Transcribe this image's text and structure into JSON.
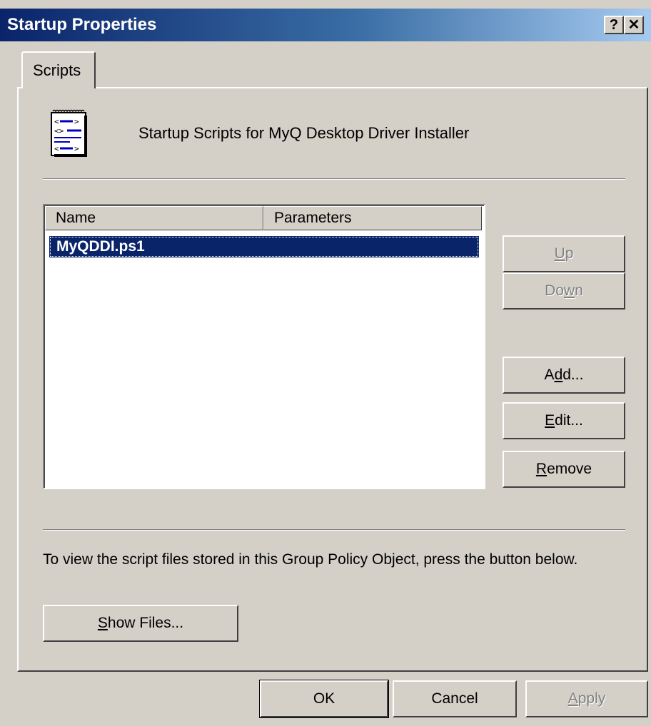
{
  "window": {
    "title": "Startup Properties",
    "help_label": "?",
    "close_label": "✕"
  },
  "tabs": [
    {
      "label": "Scripts",
      "selected": true
    }
  ],
  "header": {
    "icon": "script-icon",
    "text": "Startup Scripts for MyQ Desktop Driver Installer"
  },
  "list": {
    "columns": [
      "Name",
      "Parameters"
    ],
    "rows": [
      {
        "name": "MyQDDI.ps1",
        "parameters": "",
        "selected": true
      }
    ]
  },
  "buttons": {
    "up": {
      "label": "Up",
      "mnemonic": "U",
      "enabled": false
    },
    "down": {
      "label": "Down",
      "mnemonic": "w",
      "enabled": false
    },
    "add": {
      "label": "Add...",
      "mnemonic": "d",
      "enabled": true
    },
    "edit": {
      "label": "Edit...",
      "mnemonic": "E",
      "enabled": true
    },
    "remove": {
      "label": "Remove",
      "mnemonic": "R",
      "enabled": true
    }
  },
  "info_text": "To view the script files stored in this Group Policy Object, press the button below.",
  "show_files": {
    "label": "Show Files...",
    "mnemonic": "S"
  },
  "footer": {
    "ok": "OK",
    "cancel": "Cancel",
    "apply": {
      "label": "Apply",
      "mnemonic": "A",
      "enabled": false
    }
  },
  "colors": {
    "title_gradient_start": "#0a246a",
    "title_gradient_end": "#a6caf0",
    "face": "#d4d0c8",
    "selection": "#0a246a"
  }
}
